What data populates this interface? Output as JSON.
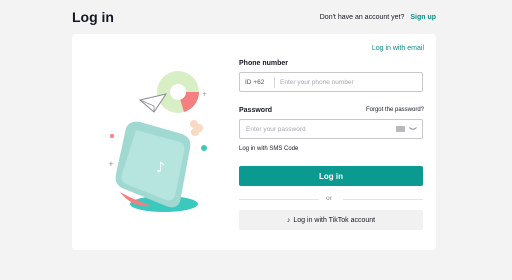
{
  "header": {
    "title": "Log in",
    "no_account_text": "Don't have an account yet?",
    "signup_label": "Sign up"
  },
  "card": {
    "email_link": "Log in with email",
    "phone_label": "Phone number",
    "country_code": "ID +62",
    "phone_placeholder": "Enter your phone number",
    "password_label": "Password",
    "forgot_link": "Forgot the password?",
    "password_placeholder": "Enter your password",
    "sms_link": "Log in with SMS Code",
    "login_button": "Log in",
    "or_text": "or",
    "tiktok_icon": "♪",
    "tiktok_button": "Log in with TikTok account"
  },
  "colors": {
    "accent": "#0a9a8f",
    "link": "#0a8f88",
    "background": "#f3f3f3",
    "phone_teal": "#9fd9d2",
    "pink": "#f47f80",
    "shadow_teal": "#3cc9bd"
  },
  "icons": {
    "illustration": "phone-illustration",
    "eye": "eye-icon",
    "tiktok": "tiktok-logo-icon"
  }
}
